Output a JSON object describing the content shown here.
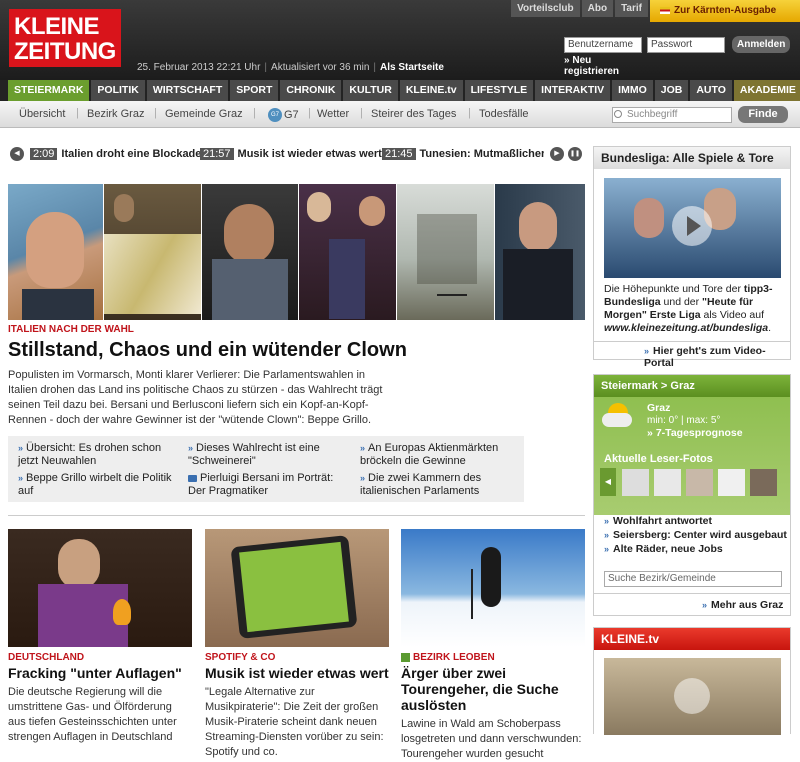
{
  "header": {
    "logo_line1": "KLEINE",
    "logo_line2": "ZEITUNG",
    "date": "25. Februar 2013 22:21 Uhr",
    "updated": "Aktualisiert vor 36 min",
    "home": "Als Startseite",
    "top_tabs": [
      "Vorteilsclub",
      "Abo",
      "Tarif"
    ],
    "kaernten": "Zur Kärnten-Ausgabe",
    "user_placeholder": "Benutzername",
    "pass_placeholder": "Passwort",
    "login": "Anmelden",
    "register": "Neu registrieren"
  },
  "nav": [
    "STEIERMARK",
    "POLITIK",
    "WIRTSCHAFT",
    "SPORT",
    "CHRONIK",
    "KULTUR",
    "KLEINE.tv",
    "LIFESTYLE",
    "INTERAKTIV",
    "IMMO",
    "JOB",
    "AUTO",
    "AKADEMIE"
  ],
  "subnav": {
    "items": [
      "Übersicht",
      "Bezirk Graz",
      "Gemeinde Graz",
      "G7",
      "Wetter",
      "Steirer des Tages",
      "Todesfälle"
    ],
    "search_placeholder": "Suchbegriff",
    "search_button": "Finde"
  },
  "ticker": [
    {
      "time": "2:09",
      "text": "Italien droht eine Blockade"
    },
    {
      "time": "21:57",
      "text": "Musik ist wieder etwas wert"
    },
    {
      "time": "21:45",
      "text": "Tunesien: Mutmaßlicher M"
    }
  ],
  "hero": {
    "kicker": "ITALIEN NACH DER WAHL",
    "title": "Stillstand, Chaos und ein wütender Clown",
    "teaser": "Populisten im Vormarsch, Monti klarer Verlierer: Die Parlamentswahlen in Italien drohen das Land ins politische Chaos zu stürzen - das Wahlrecht trägt seinen Teil dazu bei. Bersani und Berlusconi liefern sich ein Kopf-an-Kopf-Rennen - doch der wahre Gewinner ist der \"wütende Clown\": Beppe Grillo.",
    "related": [
      "Übersicht: Es drohen schon jetzt Neuwahlen",
      "Dieses Wahlrecht ist eine \"Schweinerei\"",
      "An Europas Aktienmärkten bröckeln die Gewinne",
      "Beppe Grillo wirbelt die Politik auf",
      "Pierluigi Bersani im Porträt: Der Pragmatiker",
      "Die zwei Kammern des italienischen Parlaments"
    ]
  },
  "cards": [
    {
      "kicker": "DEUTSCHLAND",
      "title": "Fracking \"unter Auflagen\"",
      "text": "Die deutsche Regierung will die umstrittene Gas- und Ölförderung aus tiefen Gesteinsschichten unter strengen Auflagen in Deutschland"
    },
    {
      "kicker": "SPOTIFY & CO",
      "title": "Musik ist wieder etwas wert",
      "text": "\"Legale Alternative zur Musikpiraterie\": Die Zeit der großen Musik-Piraterie scheint dank neuen Streaming-Diensten vorüber zu sein: Spotify und co."
    },
    {
      "kicker": "BEZIRK LEOBEN",
      "title": "Ärger über zwei Tourengeher, die Suche auslösten",
      "text": "Lawine in Wald am Schoberpass losgetreten und dann verschwunden: Tourengeher wurden gesucht"
    }
  ],
  "bundesliga": {
    "title": "Bundesliga: Alle Spiele & Tore",
    "text_a": "Die Höhepunkte und Tore der ",
    "text_b": "tipp3-Bundesliga",
    "text_c": " und der ",
    "text_d": "\"Heute für Morgen\" Erste Liga",
    "text_e": " als Video auf ",
    "text_f": "www.kleinezeitung.at/bundesliga",
    "text_g": ".",
    "link": "Hier geht's zum Video-Portal"
  },
  "graz": {
    "title": "Steiermark > Graz",
    "city": "Graz",
    "temps": "min: 0° | max: 5°",
    "forecast": "7-Tagesprognose",
    "photos_title": "Aktuelle Leser-Fotos",
    "links": [
      "Wohlfahrt antwortet",
      "Seiersberg: Center wird ausgebaut",
      "Alte Räder, neue Jobs"
    ],
    "search_placeholder": "Suche Bezirk/Gemeinde",
    "more": "Mehr aus Graz"
  },
  "kleinetv": {
    "title": "KLEINE.tv"
  }
}
